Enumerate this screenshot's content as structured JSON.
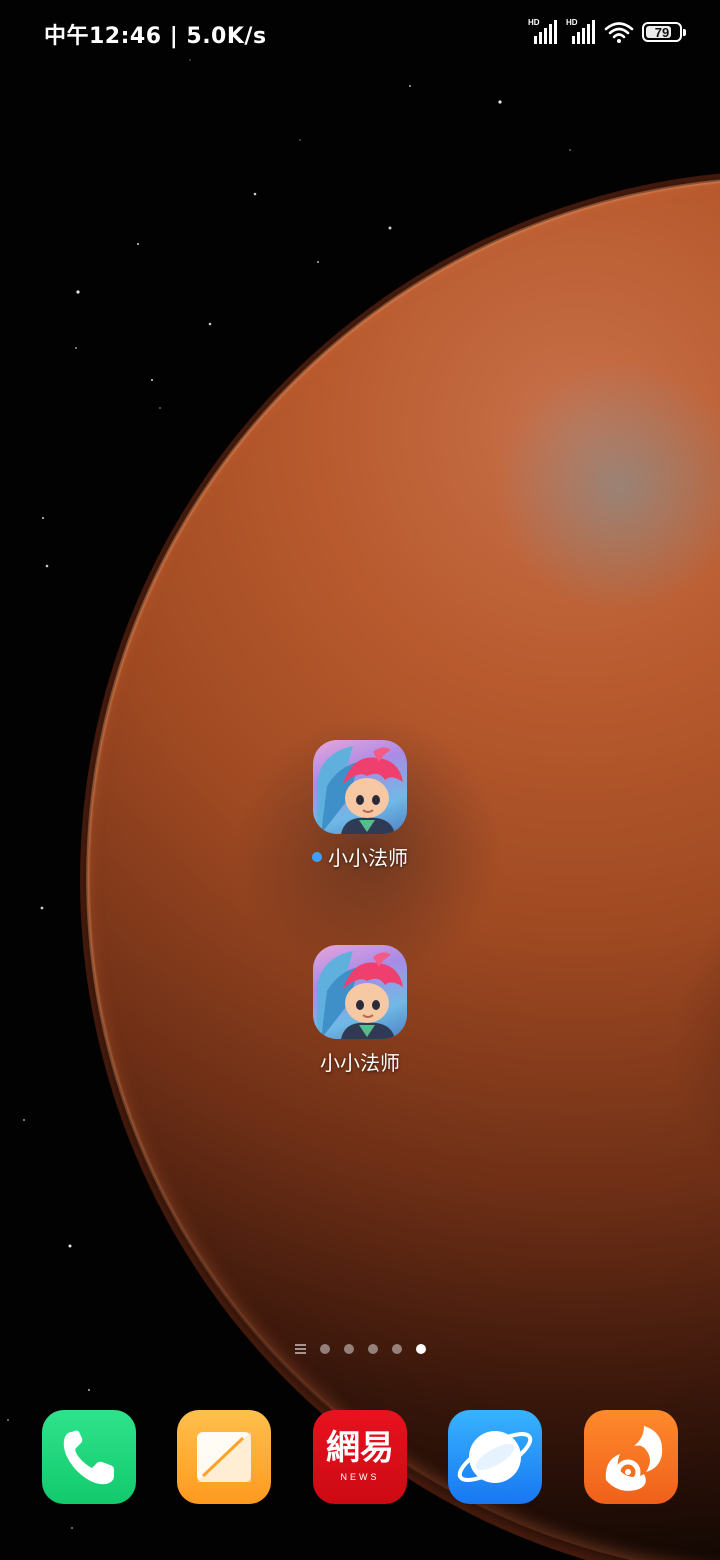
{
  "status_bar": {
    "time_and_speed": "中午12:46 | 5.0K/s",
    "signal1_label": "HD",
    "signal2_label": "HD",
    "battery_level": "79",
    "battery_fraction": 0.79
  },
  "desktop": {
    "apps": [
      {
        "label": "小小法师",
        "icon": "little-mage-game-icon",
        "has_new_badge": true
      },
      {
        "label": "小小法师",
        "icon": "little-mage-game-icon",
        "has_new_badge": false
      }
    ]
  },
  "page_indicator": {
    "page_count": 5,
    "active_page": 5
  },
  "dock": {
    "apps": [
      {
        "icon": "phone-icon",
        "color": "#1fd67c"
      },
      {
        "icon": "notes-icon",
        "color": "#ffae33"
      },
      {
        "icon": "netease-news-icon",
        "color": "#e0101c",
        "text": "網易",
        "subtext": "NEWS"
      },
      {
        "icon": "browser-icon",
        "color": "#2a95fa"
      },
      {
        "icon": "uc-browser-icon",
        "color": "#f97521"
      }
    ]
  },
  "colors": {
    "new_badge": "#3ba3ff",
    "label_text": "#ffffff"
  }
}
